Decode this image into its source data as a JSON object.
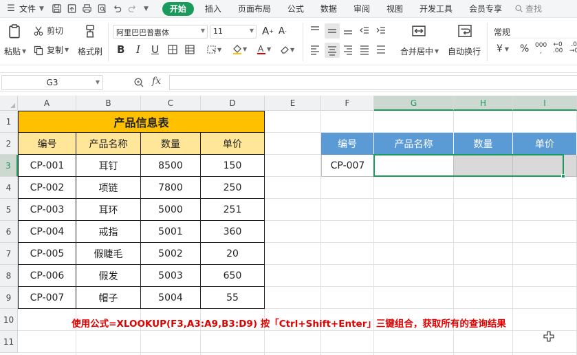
{
  "menubar": {
    "file_label": "文件",
    "tabs": [
      "开始",
      "插入",
      "页面布局",
      "公式",
      "数据",
      "审阅",
      "视图",
      "开发工具",
      "会员专享"
    ],
    "active_tab": "开始",
    "search_label": "查找"
  },
  "ribbon": {
    "paste_label": "粘贴",
    "cut_label": "剪切",
    "copy_label": "复制",
    "format_painter_label": "格式刷",
    "font_name": "阿里巴巴普惠体",
    "font_size": "11",
    "merge_label": "合并居中",
    "wrap_label": "自动换行",
    "number_format": "常规",
    "currency_symbol": "¥",
    "percent_symbol": "%"
  },
  "formula_bar": {
    "name_box": "G3",
    "fx_label": "fx",
    "formula": ""
  },
  "columns": [
    "A",
    "B",
    "C",
    "D",
    "E",
    "F",
    "G",
    "H",
    "I"
  ],
  "rows": [
    "1",
    "2",
    "3",
    "4",
    "5",
    "6",
    "7",
    "8",
    "9",
    "10",
    "11"
  ],
  "table": {
    "title": "产品信息表",
    "headers": [
      "编号",
      "产品名称",
      "数量",
      "单价"
    ],
    "rows": [
      [
        "CP-001",
        "耳钉",
        "8500",
        "150"
      ],
      [
        "CP-002",
        "项链",
        "7800",
        "250"
      ],
      [
        "CP-003",
        "耳环",
        "5000",
        "251"
      ],
      [
        "CP-004",
        "戒指",
        "5001",
        "360"
      ],
      [
        "CP-005",
        "假睫毛",
        "5002",
        "20"
      ],
      [
        "CP-006",
        "假发",
        "5003",
        "650"
      ],
      [
        "CP-007",
        "帽子",
        "5004",
        "55"
      ]
    ]
  },
  "lookup": {
    "headers": [
      "编号",
      "产品名称",
      "数量",
      "单价"
    ],
    "key": "CP-007"
  },
  "note": "使用公式=XLOOKUP(F3,A3:A9,B3:D9) 按「Ctrl+Shift+Enter」三键组合，获取所有的查询结果",
  "colors": {
    "accent": "#1a9a5b",
    "title_fill": "#ffc000",
    "header_fill": "#ffe699",
    "lookup_header": "#5b9bd5",
    "note_text": "#e00000"
  }
}
